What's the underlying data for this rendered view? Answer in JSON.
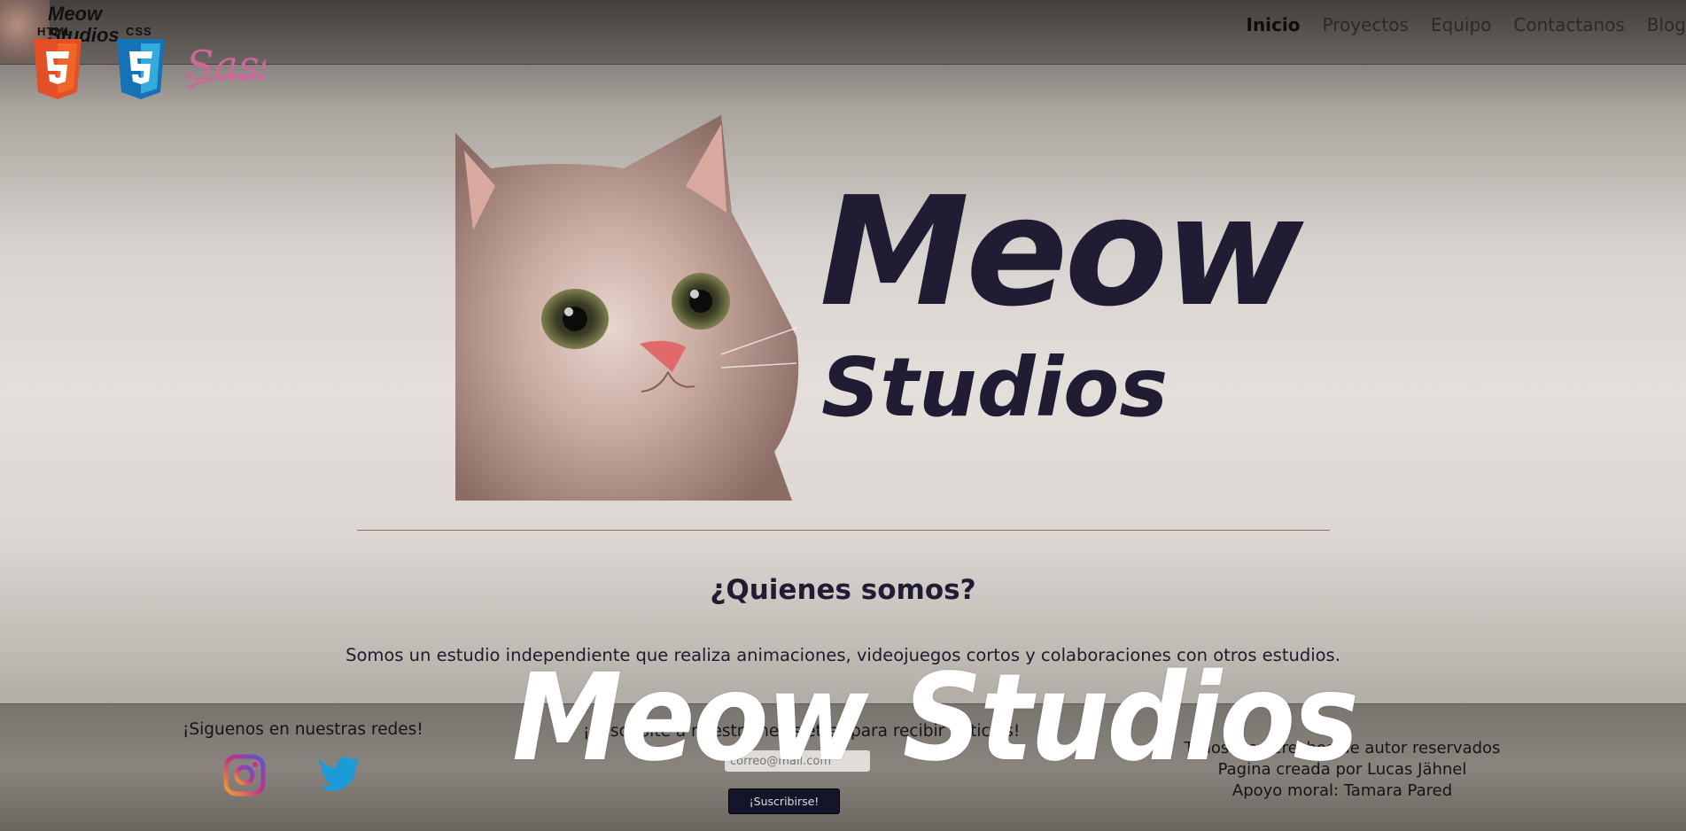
{
  "brand": {
    "line1": "Meow",
    "line2": "Studios",
    "tech": {
      "html_label": "HTML",
      "css_label": "CSS",
      "sass_label": "Sass"
    }
  },
  "nav": {
    "items": [
      {
        "label": "Inicio",
        "active": true
      },
      {
        "label": "Proyectos",
        "active": false
      },
      {
        "label": "Equipo",
        "active": false
      },
      {
        "label": "Contactanos",
        "active": false
      },
      {
        "label": "Blog",
        "active": false
      }
    ]
  },
  "hero": {
    "title_line1": "Meow",
    "title_line2": "Studios"
  },
  "about": {
    "title": "¿Quienes somos?",
    "text": "Somos un estudio independiente que realiza animaciones, videojuegos cortos y colaboraciones con otros estudios."
  },
  "footer": {
    "follow_title": "¡Siguenos en nuestras redes!",
    "subscribe_text": "¡Suscribite a nuestro newsletter para recibir noticias!",
    "subscribe_placeholder": "correo@mail.com",
    "subscribe_button": "¡Suscribirse!",
    "rights_line1": "Todos los derechos de autor reservados",
    "rights_line2": "Pagina creada por Lucas Jähnel",
    "rights_line3": "Apoyo moral: Tamara Pared"
  },
  "overlay": {
    "text": "Meow Studios"
  },
  "colors": {
    "heading": "#1f1c33",
    "divider": "#8b6e6a",
    "instagram": "#c13584",
    "twitter": "#1da1f2",
    "html5": "#e34f26",
    "css3": "#1572b6",
    "sass": "#cd6799"
  }
}
